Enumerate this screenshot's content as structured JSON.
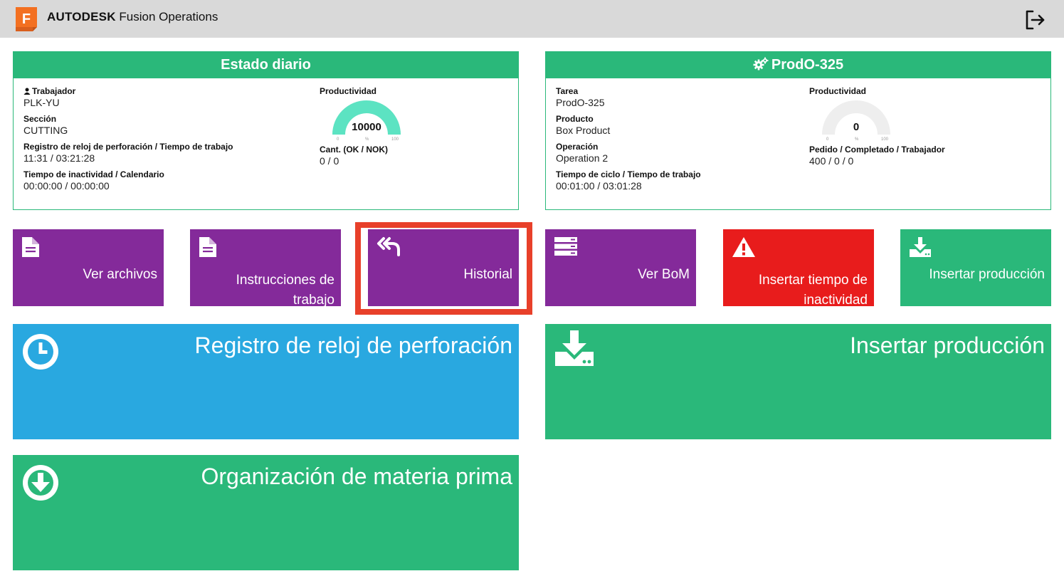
{
  "app": {
    "brand_bold": "AUTODESK",
    "brand_rest": " Fusion Operations",
    "logo_letter": "F",
    "logout_icon": "sign-out-icon"
  },
  "colors": {
    "green": "#2ab87a",
    "purple": "#842a9a",
    "red": "#e81c1c",
    "blue": "#29a8e0",
    "highlight": "#e8402a",
    "gauge_fill": "#5ce3c2",
    "gauge_empty": "#eeeeee"
  },
  "daily": {
    "title": "Estado diario",
    "worker_label": "Trabajador",
    "worker_value": "PLK-YU",
    "section_label": "Sección",
    "section_value": "CUTTING",
    "clock_label": "Registro de reloj de perforación / Tiempo de trabajo",
    "clock_value": "11:31 / 03:21:28",
    "idle_label": "Tiempo de inactividad / Calendario",
    "idle_value": "00:00:00 / 00:00:00",
    "productivity_label": "Productividad",
    "productivity_value": "10000",
    "gauge_fraction": 1,
    "gauge_min": "0",
    "gauge_unit": "%",
    "gauge_max": "100",
    "qty_label": "Cant. (OK / NOK)",
    "qty_value": "0 / 0"
  },
  "task": {
    "title": "ProdO-325",
    "title_icon": "cogs-icon",
    "task_label": "Tarea",
    "task_value": "ProdO-325",
    "product_label": "Producto",
    "product_value": "Box Product",
    "operation_label": "Operación",
    "operation_value": "Operation 2",
    "cycle_label": "Tiempo de ciclo / Tiempo de trabajo",
    "cycle_value": "00:01:00 / 03:01:28",
    "productivity_label": "Productividad",
    "productivity_value": "0",
    "gauge_fraction": 0,
    "gauge_min": "0",
    "gauge_unit": "%",
    "gauge_max": "100",
    "order_label": "Pedido / Completado / Trabajador",
    "order_value": "400 / 0 / 0"
  },
  "tiles": {
    "files": {
      "label": "Ver archivos",
      "icon": "file-icon"
    },
    "instructions": {
      "label": "Instrucciones de",
      "label2": "trabajo",
      "icon": "file-icon"
    },
    "history": {
      "label": "Historial",
      "icon": "reply-all-icon"
    },
    "bom": {
      "label": "Ver BoM",
      "icon": "server-icon"
    },
    "idle": {
      "label": "Insertar tiempo de",
      "label2": "inactividad",
      "icon": "warning-icon"
    },
    "insert_small": {
      "label": "Insertar producción",
      "icon": "download-icon"
    },
    "clock": {
      "label": "Registro de reloj de perforación",
      "icon": "clock-icon"
    },
    "insert_big": {
      "label": "Insertar producción",
      "icon": "download-icon"
    },
    "materials": {
      "label": "Organización de materia prima",
      "icon": "arrow-circle-down-icon"
    }
  }
}
